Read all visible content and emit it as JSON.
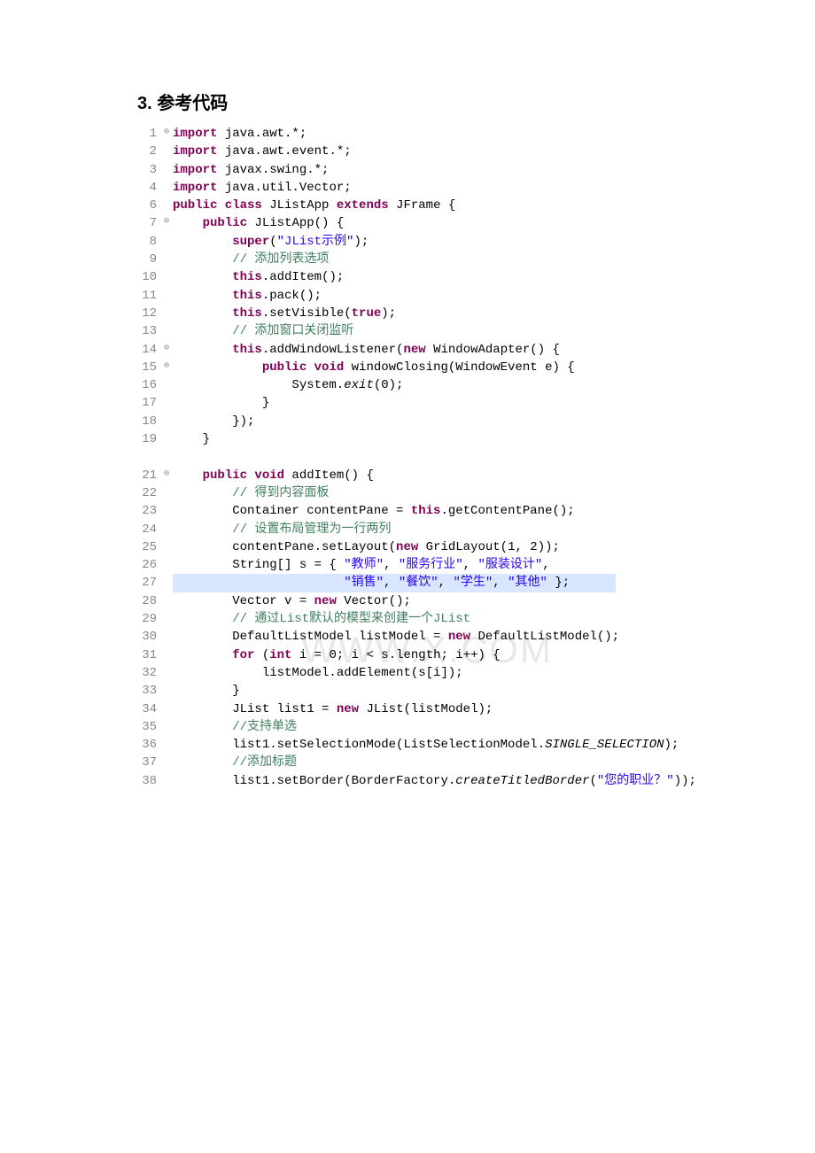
{
  "heading": "3. 参考代码",
  "watermark": "WWW.X.COM",
  "code": {
    "l1": {
      "n": "1",
      "fold": "⊖",
      "t": [
        {
          "c": "kw",
          "v": "import"
        },
        {
          "v": " java.awt.*;"
        }
      ]
    },
    "l2": {
      "n": "2",
      "t": [
        {
          "c": "kw",
          "v": "import"
        },
        {
          "v": " java.awt.event.*;"
        }
      ]
    },
    "l3": {
      "n": "3",
      "t": [
        {
          "c": "kw",
          "v": "import"
        },
        {
          "v": " javax.swing.*;"
        }
      ]
    },
    "l4": {
      "n": "4",
      "t": [
        {
          "c": "kw",
          "v": "import"
        },
        {
          "v": " java.util.Vector;"
        }
      ]
    },
    "l6": {
      "n": "6",
      "t": [
        {
          "c": "kw",
          "v": "public class"
        },
        {
          "v": " JListApp "
        },
        {
          "c": "kw",
          "v": "extends"
        },
        {
          "v": " JFrame {"
        }
      ]
    },
    "l7": {
      "n": "7",
      "fold": "⊖",
      "t": [
        {
          "v": "    "
        },
        {
          "c": "kw",
          "v": "public"
        },
        {
          "v": " JListApp() {"
        }
      ]
    },
    "l8": {
      "n": "8",
      "t": [
        {
          "v": "        "
        },
        {
          "c": "kw",
          "v": "super"
        },
        {
          "v": "("
        },
        {
          "c": "str",
          "v": "\"JList示例\""
        },
        {
          "v": ");"
        }
      ]
    },
    "l9": {
      "n": "9",
      "t": [
        {
          "v": "        "
        },
        {
          "c": "cm",
          "v": "// 添加列表选项"
        }
      ]
    },
    "l10": {
      "n": "10",
      "t": [
        {
          "v": "        "
        },
        {
          "c": "kw",
          "v": "this"
        },
        {
          "v": ".addItem();"
        }
      ]
    },
    "l11": {
      "n": "11",
      "t": [
        {
          "v": "        "
        },
        {
          "c": "kw",
          "v": "this"
        },
        {
          "v": ".pack();"
        }
      ]
    },
    "l12": {
      "n": "12",
      "t": [
        {
          "v": "        "
        },
        {
          "c": "kw",
          "v": "this"
        },
        {
          "v": ".setVisible("
        },
        {
          "c": "kw",
          "v": "true"
        },
        {
          "v": ");"
        }
      ]
    },
    "l13": {
      "n": "13",
      "t": [
        {
          "v": "        "
        },
        {
          "c": "cm",
          "v": "// 添加窗口关闭监听"
        }
      ]
    },
    "l14": {
      "n": "14",
      "fold": "⊖",
      "t": [
        {
          "v": "        "
        },
        {
          "c": "kw",
          "v": "this"
        },
        {
          "v": ".addWindowListener("
        },
        {
          "c": "kw",
          "v": "new"
        },
        {
          "v": " WindowAdapter() {"
        }
      ]
    },
    "l15": {
      "n": "15",
      "fold": "⊖",
      "t": [
        {
          "v": "            "
        },
        {
          "c": "kw",
          "v": "public void"
        },
        {
          "v": " windowClosing(WindowEvent e) {"
        }
      ]
    },
    "l16": {
      "n": "16",
      "t": [
        {
          "v": "                System."
        },
        {
          "c": "it",
          "v": "exit"
        },
        {
          "v": "(0);"
        }
      ]
    },
    "l17": {
      "n": "17",
      "t": [
        {
          "v": "            }"
        }
      ]
    },
    "l18": {
      "n": "18",
      "t": [
        {
          "v": "        });"
        }
      ]
    },
    "l19": {
      "n": "19",
      "t": [
        {
          "v": "    }"
        }
      ]
    },
    "l21": {
      "n": "21",
      "fold": "⊖",
      "t": [
        {
          "v": "    "
        },
        {
          "c": "kw",
          "v": "public void"
        },
        {
          "v": " addItem() {"
        }
      ]
    },
    "l22": {
      "n": "22",
      "t": [
        {
          "v": "        "
        },
        {
          "c": "cm",
          "v": "// 得到内容面板"
        }
      ]
    },
    "l23": {
      "n": "23",
      "t": [
        {
          "v": "        Container contentPane = "
        },
        {
          "c": "kw",
          "v": "this"
        },
        {
          "v": ".getContentPane();"
        }
      ]
    },
    "l24": {
      "n": "24",
      "t": [
        {
          "v": "        "
        },
        {
          "c": "cm",
          "v": "// 设置布局管理为一行两列"
        }
      ]
    },
    "l25": {
      "n": "25",
      "t": [
        {
          "v": "        contentPane.setLayout("
        },
        {
          "c": "kw",
          "v": "new"
        },
        {
          "v": " GridLayout(1, 2));"
        }
      ]
    },
    "l26": {
      "n": "26",
      "t": [
        {
          "v": "        String[] s = { "
        },
        {
          "c": "str",
          "v": "\"教师\""
        },
        {
          "v": ", "
        },
        {
          "c": "str",
          "v": "\"服务行业\""
        },
        {
          "v": ", "
        },
        {
          "c": "str",
          "v": "\"服装设计\""
        },
        {
          "v": ","
        }
      ]
    },
    "l27": {
      "n": "27",
      "hl": true,
      "t": [
        {
          "v": "                       "
        },
        {
          "c": "str",
          "v": "\"销售\""
        },
        {
          "v": ", "
        },
        {
          "c": "str",
          "v": "\"餐饮\""
        },
        {
          "v": ", "
        },
        {
          "c": "str",
          "v": "\"学生\""
        },
        {
          "v": ", "
        },
        {
          "c": "str",
          "v": "\"其他\""
        },
        {
          "v": " };"
        }
      ]
    },
    "l28": {
      "n": "28",
      "t": [
        {
          "v": "        Vector v = "
        },
        {
          "c": "kw",
          "v": "new"
        },
        {
          "v": " Vector();"
        }
      ]
    },
    "l29": {
      "n": "29",
      "t": [
        {
          "v": "        "
        },
        {
          "c": "cm",
          "v": "// 通过List默认的模型来创建一个JList"
        }
      ]
    },
    "l30": {
      "n": "30",
      "t": [
        {
          "v": "        DefaultListModel listModel = "
        },
        {
          "c": "kw",
          "v": "new"
        },
        {
          "v": " DefaultListModel();"
        }
      ]
    },
    "l31": {
      "n": "31",
      "t": [
        {
          "v": "        "
        },
        {
          "c": "kw",
          "v": "for"
        },
        {
          "v": " ("
        },
        {
          "c": "kw",
          "v": "int"
        },
        {
          "v": " i = 0; i < s.length; i++) {"
        }
      ]
    },
    "l32": {
      "n": "32",
      "t": [
        {
          "v": "            listModel.addElement(s[i]);"
        }
      ]
    },
    "l33": {
      "n": "33",
      "t": [
        {
          "v": "        }"
        }
      ]
    },
    "l34": {
      "n": "34",
      "t": [
        {
          "v": "        JList list1 = "
        },
        {
          "c": "kw",
          "v": "new"
        },
        {
          "v": " JList(listModel);"
        }
      ]
    },
    "l35": {
      "n": "35",
      "t": [
        {
          "v": "        "
        },
        {
          "c": "cm",
          "v": "//支持单选"
        }
      ]
    },
    "l36": {
      "n": "36",
      "t": [
        {
          "v": "        list1.setSelectionMode(ListSelectionModel."
        },
        {
          "c": "it",
          "v": "SINGLE_SELECTION"
        },
        {
          "v": ");"
        }
      ]
    },
    "l37": {
      "n": "37",
      "t": [
        {
          "v": "        "
        },
        {
          "c": "cm",
          "v": "//添加标题"
        }
      ]
    },
    "l38": {
      "n": "38",
      "t": [
        {
          "v": "        list1.setBorder(BorderFactory."
        },
        {
          "c": "it",
          "v": "createTitledBorder"
        },
        {
          "v": "("
        },
        {
          "c": "str",
          "v": "\"您的职业？\""
        },
        {
          "v": "));"
        }
      ]
    }
  },
  "order": [
    "l1",
    "l2",
    "l3",
    "l4",
    "l6",
    "l7",
    "l8",
    "l9",
    "l10",
    "l11",
    "l12",
    "l13",
    "l14",
    "l15",
    "l16",
    "l17",
    "l18",
    "l19",
    "blank",
    "l21",
    "l22",
    "l23",
    "l24",
    "l25",
    "l26",
    "l27",
    "l28",
    "l29",
    "l30",
    "l31",
    "l32",
    "l33",
    "l34",
    "l35",
    "l36",
    "l37",
    "l38"
  ]
}
